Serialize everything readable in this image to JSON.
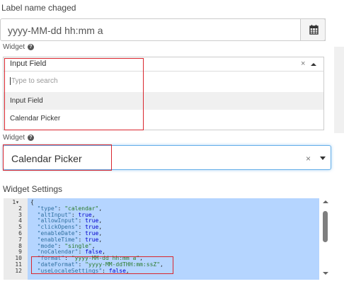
{
  "top_field": {
    "label": "Label name chaged",
    "value": "yyyy-MM-dd hh:mm a",
    "button_icon": "calendar-icon"
  },
  "widget_section_1": {
    "label": "Widget",
    "help_icon": "question-circle-icon",
    "selected": "Input Field",
    "clear": "×",
    "search_placeholder": "Type to search",
    "options": [
      "Input Field",
      "Calendar Picker"
    ]
  },
  "widget_section_2": {
    "label": "Widget",
    "help_icon": "question-circle-icon",
    "selected": "Calendar Picker",
    "clear": "×"
  },
  "widget_settings": {
    "title": "Widget Settings",
    "lines": [
      {
        "n": "1",
        "text": "{"
      },
      {
        "n": "2",
        "key": "\"type\"",
        "val": "\"calendar\"",
        "vtype": "s"
      },
      {
        "n": "3",
        "key": "\"altInput\"",
        "val": "true",
        "vtype": "b"
      },
      {
        "n": "4",
        "key": "\"allowInput\"",
        "val": "true",
        "vtype": "b"
      },
      {
        "n": "5",
        "key": "\"clickOpens\"",
        "val": "true",
        "vtype": "b"
      },
      {
        "n": "6",
        "key": "\"enableDate\"",
        "val": "true",
        "vtype": "b"
      },
      {
        "n": "7",
        "key": "\"enableTime\"",
        "val": "true",
        "vtype": "b"
      },
      {
        "n": "8",
        "key": "\"mode\"",
        "val": "\"single\"",
        "vtype": "s"
      },
      {
        "n": "9",
        "key": "\"noCalendar\"",
        "val": "false",
        "vtype": "b"
      },
      {
        "n": "10",
        "key": "\"format\"",
        "val": "\"yyyy-MM-dd hh:mm a\"",
        "vtype": "s"
      },
      {
        "n": "11",
        "key": "\"dateFormat\"",
        "val": "\"yyyy-MM-ddTHH:mm:ssZ\"",
        "vtype": "s"
      },
      {
        "n": "12",
        "key": "\"useLocaleSettings\"",
        "val": "false",
        "vtype": "b"
      }
    ]
  }
}
